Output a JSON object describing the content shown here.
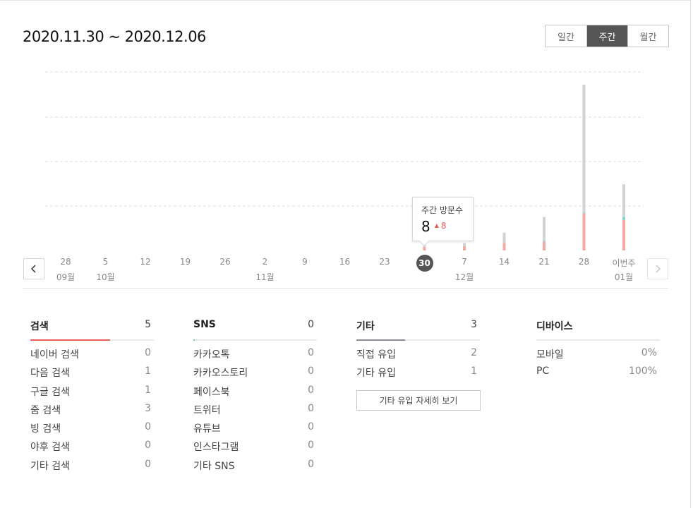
{
  "header": {
    "date_range": "2020.11.30 ~ 2020.12.06"
  },
  "period_toggle": {
    "options": [
      "일간",
      "주간",
      "월간"
    ],
    "selected": "주간"
  },
  "colors": {
    "accent_red": "#e8605a",
    "bar_gray": "#cfd3d8",
    "bar_pink": "#f3aaa4",
    "bar_teal": "#7dd3cf",
    "active_btn": "#555555",
    "search_bar": "#e8605a",
    "sns_bar": "#5fcfc6",
    "etc_bar": "#8a8e9a"
  },
  "chart": {
    "x_labels": [
      "28",
      "5",
      "12",
      "19",
      "26",
      "2",
      "9",
      "16",
      "23",
      "30",
      "7",
      "14",
      "21",
      "28",
      "이번주"
    ],
    "month_labels": [
      {
        "index": 0,
        "label": "09월"
      },
      {
        "index": 1,
        "label": "10월"
      },
      {
        "index": 5,
        "label": "11월"
      },
      {
        "index": 10,
        "label": "12월"
      },
      {
        "index": 14,
        "label": "01월"
      }
    ],
    "selected_index": 9
  },
  "chart_data": {
    "type": "bar",
    "stacked": true,
    "categories": [
      "28",
      "5",
      "12",
      "19",
      "26",
      "2",
      "9",
      "16",
      "23",
      "30",
      "7",
      "14",
      "21",
      "28",
      "이번주"
    ],
    "series": [
      {
        "color": "#f3aaa4",
        "values": [
          0,
          0,
          0,
          0,
          0,
          0,
          0,
          0,
          0,
          5,
          6,
          10,
          12,
          50,
          41
        ]
      },
      {
        "color": "#7dd3cf",
        "values": [
          0,
          0,
          0,
          0,
          0,
          0,
          0,
          0,
          0,
          0,
          0,
          0,
          1,
          1,
          4
        ]
      },
      {
        "color": "#cfd3d8",
        "values": [
          0,
          0,
          0,
          0,
          0,
          0,
          0,
          0,
          0,
          3,
          4,
          14,
          32,
          172,
          44
        ]
      }
    ],
    "ylim": [
      0,
      240
    ],
    "grid": true,
    "tooltip": {
      "title": "주간 방문수",
      "value": "8",
      "change": "8",
      "change_direction": "up"
    }
  },
  "stats": {
    "search": {
      "title": "검색",
      "total": "5",
      "items": [
        {
          "label": "네이버 검색",
          "value": "0"
        },
        {
          "label": "다음 검색",
          "value": "1"
        },
        {
          "label": "구글 검색",
          "value": "1"
        },
        {
          "label": "줌 검색",
          "value": "3"
        },
        {
          "label": "빙 검색",
          "value": "0"
        },
        {
          "label": "야후 검색",
          "value": "0"
        },
        {
          "label": "기타 검색",
          "value": "0"
        }
      ]
    },
    "sns": {
      "title": "SNS",
      "total": "0",
      "items": [
        {
          "label": "카카오톡",
          "value": "0"
        },
        {
          "label": "카카오스토리",
          "value": "0"
        },
        {
          "label": "페이스북",
          "value": "0"
        },
        {
          "label": "트위터",
          "value": "0"
        },
        {
          "label": "유튜브",
          "value": "0"
        },
        {
          "label": "인스타그램",
          "value": "0"
        },
        {
          "label": "기타 SNS",
          "value": "0"
        }
      ]
    },
    "etc": {
      "title": "기타",
      "total": "3",
      "items": [
        {
          "label": "직접 유입",
          "value": "2"
        },
        {
          "label": "기타 유입",
          "value": "1"
        }
      ],
      "detail_button": "기타 유입 자세히 보기"
    },
    "device": {
      "title": "디바이스",
      "items": [
        {
          "label": "모바일",
          "value": "0%"
        },
        {
          "label": "PC",
          "value": "100%"
        }
      ]
    }
  }
}
